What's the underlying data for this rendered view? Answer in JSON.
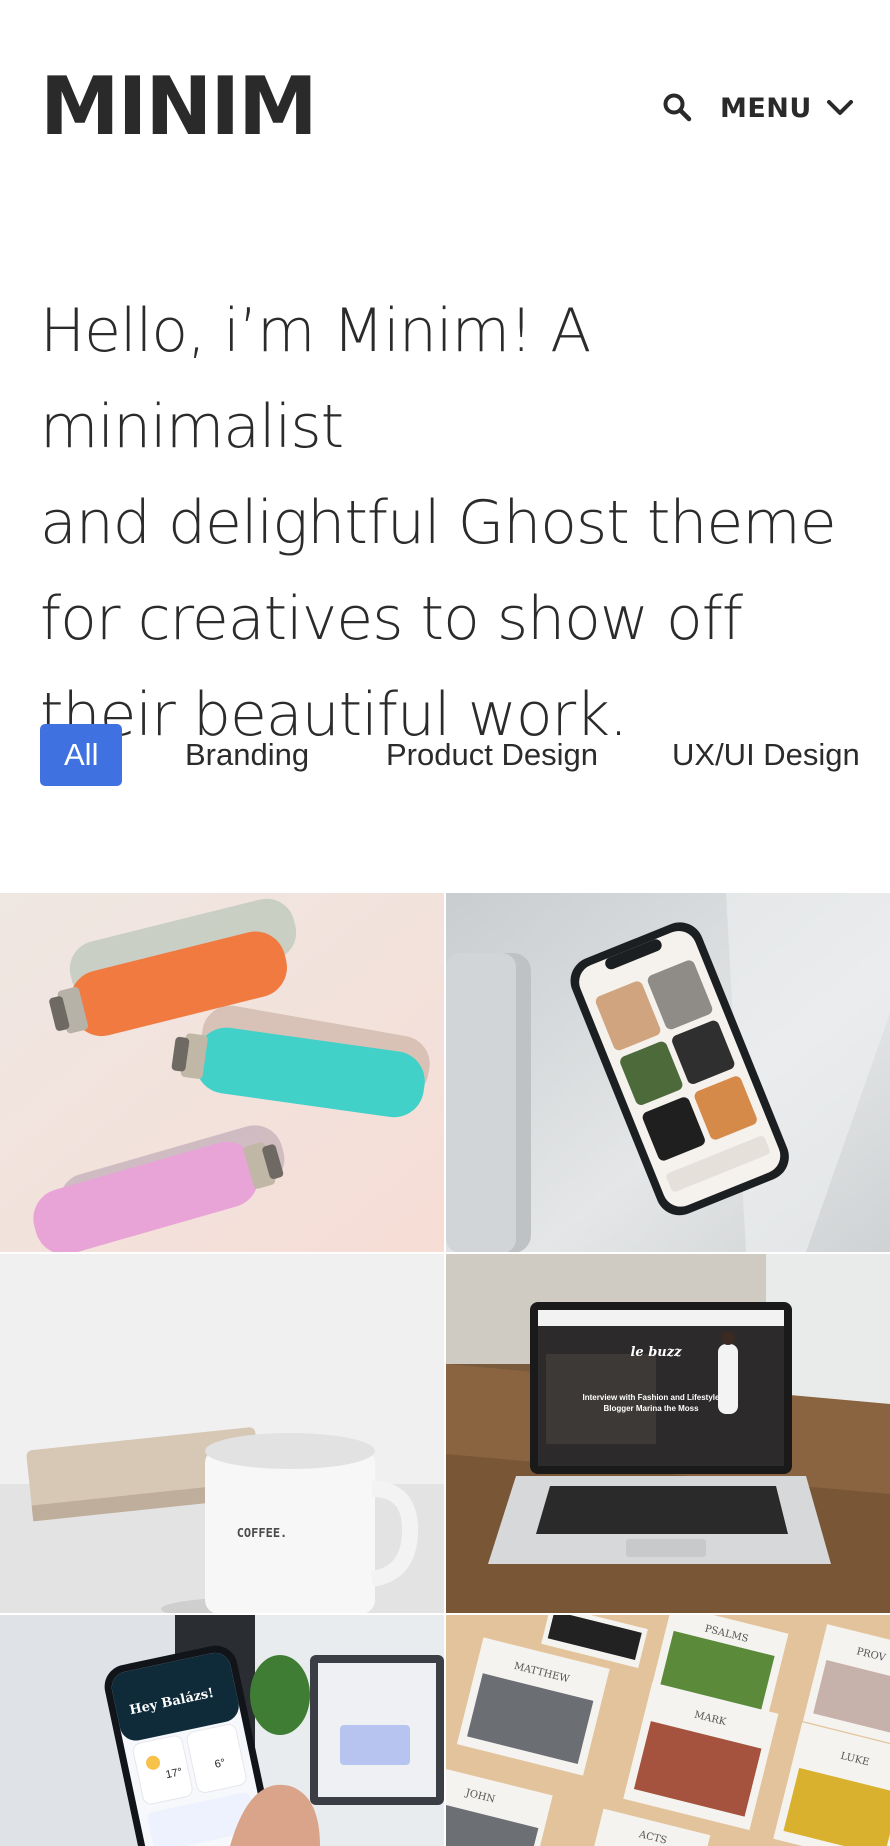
{
  "header": {
    "logo": "MINIM",
    "menu_label": "MENU"
  },
  "hero": {
    "line1": "Hello, i’m Minim! A minimalist",
    "line2": "and delightful Ghost theme",
    "line3": "for creatives to show off",
    "line4": "their beautiful work."
  },
  "filters": [
    {
      "label": "All",
      "active": true
    },
    {
      "label": "Branding",
      "active": false
    },
    {
      "label": "Product Design",
      "active": false
    },
    {
      "label": "UX/UI Design",
      "active": false
    }
  ],
  "tiles": {
    "mug_text": "COFFEE.",
    "laptop_brand": "le buzz",
    "laptop_headline1": "Interview with Fashion and Lifestyle",
    "laptop_headline2": "Blogger Marina the Moss",
    "phone_app_greeting": "Hey Balázs!",
    "phone_temp1": "17°",
    "phone_temp2": "6°",
    "book_titles": [
      "PSALMS",
      "MATTHEW",
      "MARK",
      "PROV",
      "LUKE",
      "JOHN",
      "ACTS"
    ]
  },
  "colors": {
    "accent": "#3f72e0",
    "text": "#2b2b2b"
  }
}
